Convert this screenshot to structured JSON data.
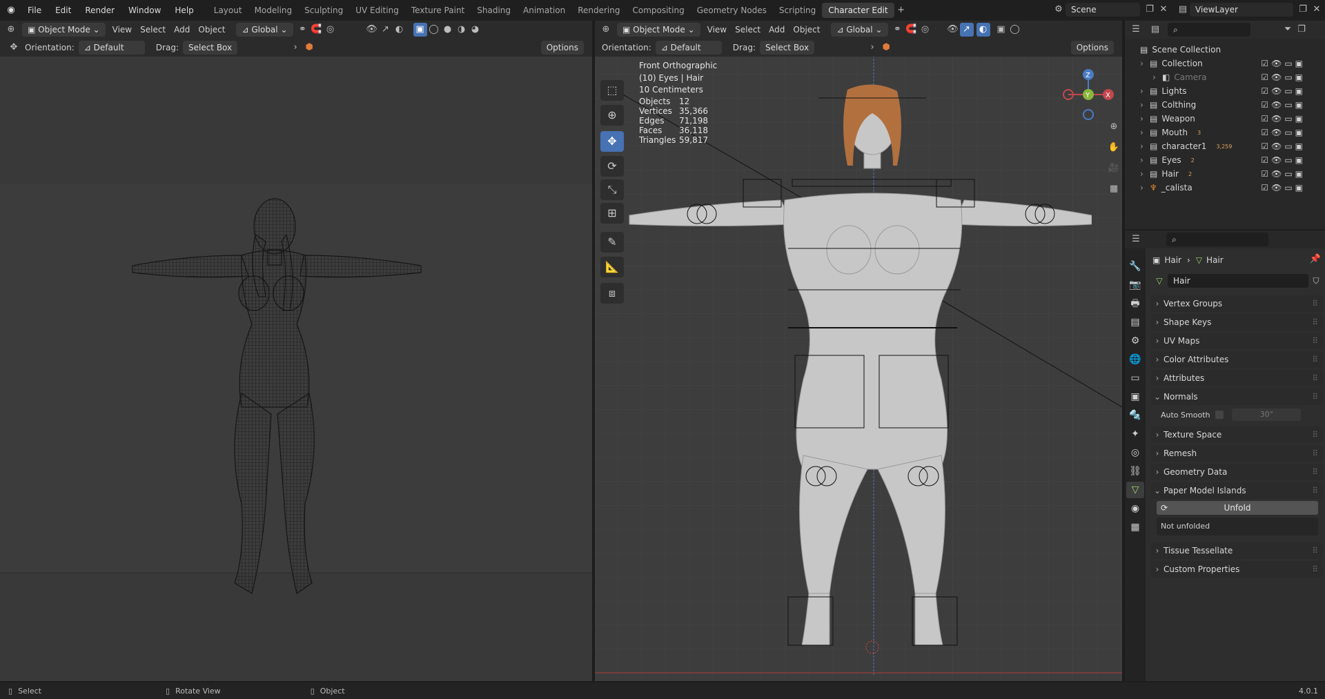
{
  "app": {
    "version": "4.0.1"
  },
  "menu": [
    "File",
    "Edit",
    "Render",
    "Window",
    "Help"
  ],
  "workspaces": [
    "Layout",
    "Modeling",
    "Sculpting",
    "UV Editing",
    "Texture Paint",
    "Shading",
    "Animation",
    "Rendering",
    "Compositing",
    "Geometry Nodes",
    "Scripting",
    "Character Edit"
  ],
  "active_workspace": "Character Edit",
  "scene": {
    "name": "Scene",
    "view_layer": "ViewLayer"
  },
  "left_view": {
    "mode": "Object Mode",
    "menus": [
      "View",
      "Select",
      "Add",
      "Object"
    ],
    "transform": "Global",
    "orientation_label": "Orientation:",
    "orientation": "Default",
    "drag_label": "Drag:",
    "drag": "Select Box",
    "options": "Options"
  },
  "right_view": {
    "mode": "Object Mode",
    "menus": [
      "View",
      "Select",
      "Add",
      "Object"
    ],
    "transform": "Global",
    "orientation_label": "Orientation:",
    "orientation": "Default",
    "drag_label": "Drag:",
    "drag": "Select Box",
    "options": "Options",
    "overlay": {
      "view_name": "Front Orthographic",
      "active": "(10) Eyes | Hair",
      "scale": "10 Centimeters"
    },
    "stats": [
      {
        "k": "Objects",
        "v": "12"
      },
      {
        "k": "Vertices",
        "v": "35,366"
      },
      {
        "k": "Edges",
        "v": "71,198"
      },
      {
        "k": "Faces",
        "v": "36,118"
      },
      {
        "k": "Triangles",
        "v": "59,817"
      }
    ],
    "gizmo": {
      "z": "Z",
      "y": "Y",
      "x": "X"
    }
  },
  "outliner": {
    "root": "Scene Collection",
    "items": [
      {
        "label": "Collection",
        "indent": 0,
        "icon": "collection-icon"
      },
      {
        "label": "Camera",
        "indent": 1,
        "icon": "camera-icon",
        "dim": true
      },
      {
        "label": "Lights",
        "indent": 0,
        "icon": "collection-icon"
      },
      {
        "label": "Colthing",
        "indent": 0,
        "icon": "collection-icon"
      },
      {
        "label": "Weapon",
        "indent": 0,
        "icon": "collection-icon"
      },
      {
        "label": "Mouth",
        "indent": 0,
        "icon": "collection-icon",
        "sub": "3"
      },
      {
        "label": "character1",
        "indent": 0,
        "icon": "collection-icon",
        "sub": "3,259"
      },
      {
        "label": "Eyes",
        "indent": 0,
        "icon": "collection-icon",
        "sub": "2"
      },
      {
        "label": "Hair",
        "indent": 0,
        "icon": "collection-icon",
        "sub": "2"
      },
      {
        "label": "_calista",
        "indent": 0,
        "icon": "armature-icon"
      }
    ]
  },
  "properties": {
    "breadcrumb_obj": "Hair",
    "breadcrumb_data": "Hair",
    "datablock": "Hair",
    "panels": [
      {
        "label": "Vertex Groups",
        "open": false
      },
      {
        "label": "Shape Keys",
        "open": false
      },
      {
        "label": "UV Maps",
        "open": false
      },
      {
        "label": "Color Attributes",
        "open": false
      },
      {
        "label": "Attributes",
        "open": false
      },
      {
        "label": "Normals",
        "open": true
      }
    ],
    "auto_smooth_label": "Auto Smooth",
    "auto_smooth_angle": "30°",
    "panels2": [
      {
        "label": "Texture Space",
        "open": false
      },
      {
        "label": "Remesh",
        "open": false
      },
      {
        "label": "Geometry Data",
        "open": false
      },
      {
        "label": "Paper Model Islands",
        "open": true
      }
    ],
    "unfold_label": "Unfold",
    "unfold_status": "Not unfolded",
    "panels3": [
      {
        "label": "Tissue Tessellate",
        "open": false
      },
      {
        "label": "Custom Properties",
        "open": false
      }
    ]
  },
  "statusbar": {
    "select": "Select",
    "rotate": "Rotate View",
    "object": "Object"
  }
}
